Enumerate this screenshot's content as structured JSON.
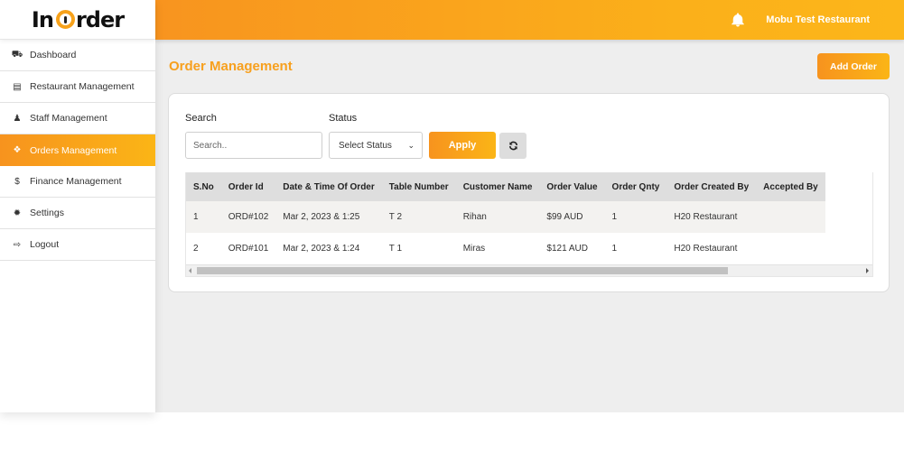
{
  "brand": {
    "logo_left": "In",
    "logo_right": "rder",
    "accent": "#f7a01e"
  },
  "sidebar": {
    "items": [
      {
        "label": "Dashboard",
        "icon": "dashboard-icon",
        "glyph": "⛟",
        "active": false
      },
      {
        "label": "Restaurant Management",
        "icon": "building-icon",
        "glyph": "▤",
        "active": false
      },
      {
        "label": "Staff Management",
        "icon": "person-icon",
        "glyph": "♟",
        "active": false
      },
      {
        "label": "Orders Management",
        "icon": "cubes-icon",
        "glyph": "❖",
        "active": true
      },
      {
        "label": "Finance Management",
        "icon": "dollar-icon",
        "glyph": "$",
        "active": false
      },
      {
        "label": "Settings",
        "icon": "gear-icon",
        "glyph": "✹",
        "active": false
      },
      {
        "label": "Logout",
        "icon": "logout-icon",
        "glyph": "⇨",
        "active": false
      }
    ]
  },
  "header": {
    "restaurant_name": "Mobu Test Restaurant",
    "bell_icon": "bell-icon"
  },
  "main": {
    "title": "Order Management",
    "add_order_label": "Add Order",
    "filters": {
      "search_label": "Search",
      "search_placeholder": "Search..",
      "search_value": "",
      "status_label": "Status",
      "status_selected": "Select Status",
      "apply_label": "Apply",
      "refresh_icon": "refresh-icon"
    },
    "table": {
      "columns": [
        "S.No",
        "Order Id",
        "Date & Time Of Order",
        "Table Number",
        "Customer Name",
        "Order Value",
        "Order Qnty",
        "Order Created By",
        "Accepted By"
      ],
      "rows": [
        [
          "1",
          "ORD#102",
          "Mar 2, 2023 & 1:25",
          "T 2",
          "Rihan",
          "$99 AUD",
          "1",
          "H20 Restaurant",
          ""
        ],
        [
          "2",
          "ORD#101",
          "Mar 2, 2023 & 1:24",
          "T 1",
          "Miras",
          "$121 AUD",
          "1",
          "H20 Restaurant",
          ""
        ]
      ]
    }
  }
}
